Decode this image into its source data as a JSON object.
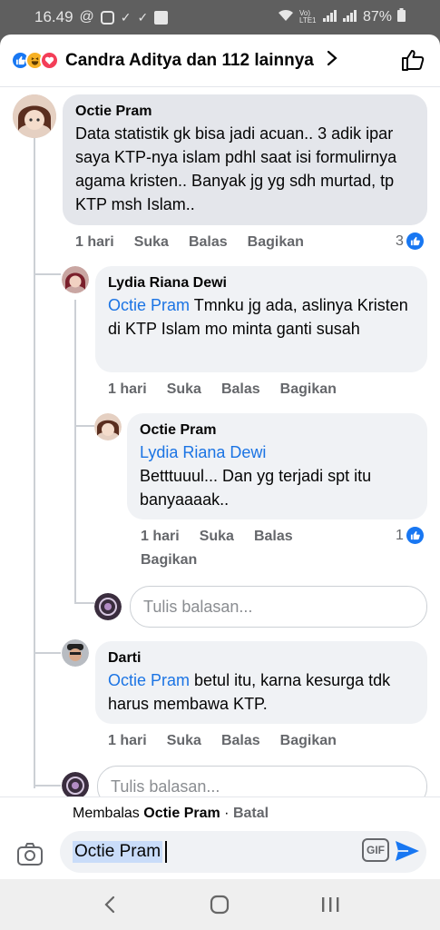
{
  "status_bar": {
    "time": "16.49",
    "network": "Vo) LTE1",
    "battery": "87%"
  },
  "reactions": {
    "label": "Candra Aditya dan 112 lainnya",
    "colors": {
      "like": "#1877f2",
      "haha": "#f7b125",
      "love": "#f33e58"
    }
  },
  "comments": [
    {
      "author": "Octie Pram",
      "text": "Data statistik gk bisa jadi acuan.. 3 adik ipar saya KTP-nya islam pdhl saat isi formulirnya agama kristen.. Banyak jg yg sdh murtad, tp KTP msh Islam..",
      "time": "1 hari",
      "like": "Suka",
      "reply": "Balas",
      "share": "Bagikan",
      "reaction_count": "3"
    },
    {
      "author": "Lydia Riana Dewi",
      "mention": "Octie Pram",
      "text": " Tmnku jg ada, aslinya Kristen di KTP Islam mo minta ganti susah",
      "time": "1 hari",
      "like": "Suka",
      "reply": "Balas",
      "share": "Bagikan"
    },
    {
      "author": "Octie Pram",
      "mention": "Lydia Riana Dewi",
      "text": "Betttuuul... Dan yg terjadi spt itu banyaaaak..",
      "time": "1 hari",
      "like": "Suka",
      "reply": "Balas",
      "share": "Bagikan",
      "reaction_count": "1"
    },
    {
      "author": "Darti",
      "mention": "Octie Pram",
      "text": " betul itu, karna kesurga tdk harus membawa KTP.",
      "time": "1 hari",
      "like": "Suka",
      "reply": "Balas",
      "share": "Bagikan"
    }
  ],
  "reply_placeholder": "Tulis balasan...",
  "composer": {
    "replying_prefix": "Membalas ",
    "replying_to": "Octie Pram",
    "separator": " · ",
    "cancel": "Batal",
    "value": "Octie Pram",
    "gif_label": "GIF"
  },
  "icons": [
    "like-icon",
    "haha-icon",
    "love-icon",
    "chevron-right-icon",
    "thumbs-up-outline-icon",
    "camera-icon",
    "gif-icon",
    "send-icon",
    "back-icon",
    "home-icon",
    "recents-icon"
  ]
}
